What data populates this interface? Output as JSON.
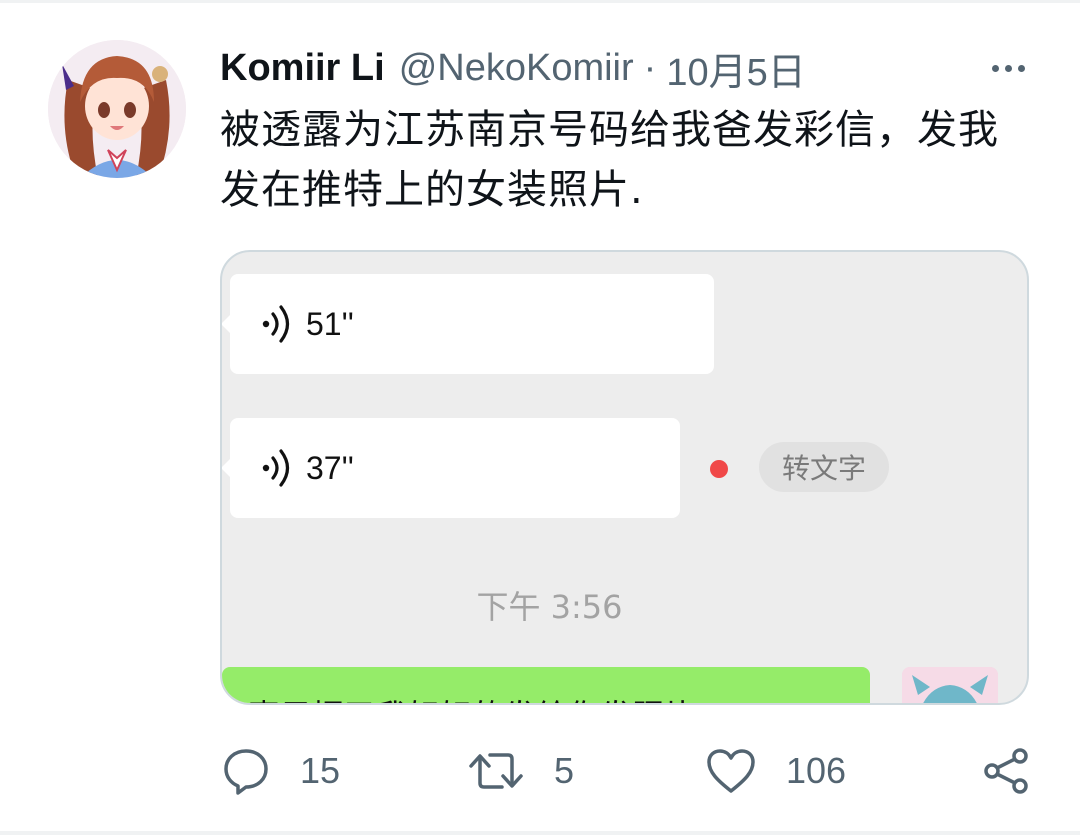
{
  "tweet": {
    "display_name": "Komiir Li",
    "handle": "@NekoKomiir",
    "separator": "·",
    "date": "10月5日",
    "text_line1": "被透露为江苏南京号码给我爸发彩信，发我",
    "text_line2": "发在推特上的女装照片."
  },
  "chat": {
    "voice_messages": [
      {
        "duration": "51''"
      },
      {
        "duration": "37''"
      }
    ],
    "convert_to_text": "转文字",
    "timestamp": "下午 3:56",
    "partial_message": "妻子据了我好好的发给你发照片"
  },
  "actions": {
    "reply_count": "15",
    "retweet_count": "5",
    "like_count": "106"
  },
  "colors": {
    "text_primary": "#0f1419",
    "text_secondary": "#536471",
    "chat_bg": "#ededed",
    "wechat_green": "#95ec69",
    "unread_red": "#f04848"
  },
  "icons": [
    "more-icon",
    "voice-icon",
    "reply-icon",
    "retweet-icon",
    "like-icon",
    "share-icon"
  ]
}
